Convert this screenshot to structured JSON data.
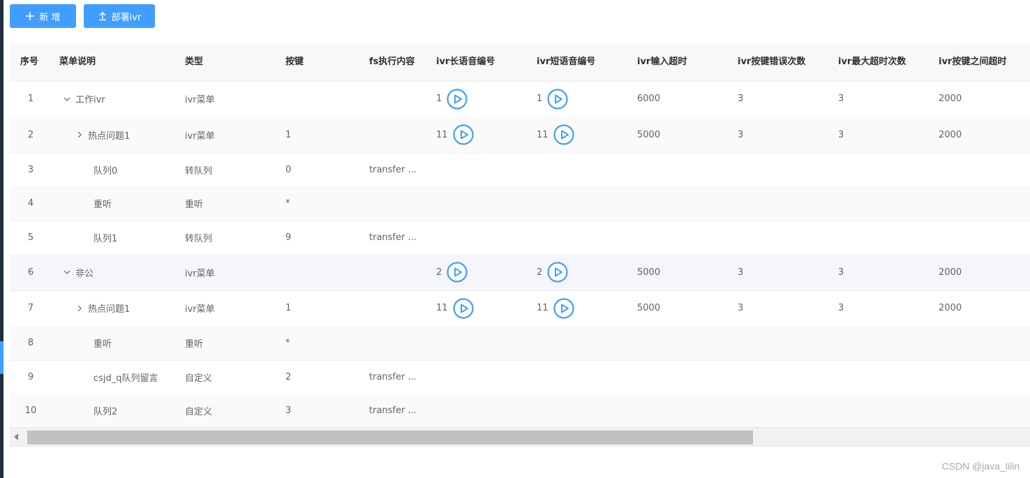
{
  "toolbar": {
    "add_label": "新 增",
    "deploy_label": "部署ivr"
  },
  "table": {
    "headers": {
      "index": "序号",
      "menu": "菜单说明",
      "type": "类型",
      "key": "按键",
      "fs": "fs执行内容",
      "long_voice": "ivr长语音编号",
      "short_voice": "ivr短语音编号",
      "input_timeout": "ivr输入超时",
      "key_errors": "ivr按键错误次数",
      "max_timeouts": "ivr最大超时次数",
      "inter_key_timeout": "ivr按键之间超时"
    },
    "rows": [
      {
        "index": "1",
        "menu": "工作ivr",
        "type": "ivr菜单",
        "key": "",
        "fs": "",
        "long_voice": "1",
        "short_voice": "1",
        "input_timeout": "6000",
        "key_errors": "3",
        "max_timeouts": "3",
        "inter_key_timeout": "2000"
      },
      {
        "index": "2",
        "menu": "热点问题1",
        "type": "ivr菜单",
        "key": "1",
        "fs": "",
        "long_voice": "11",
        "short_voice": "11",
        "input_timeout": "5000",
        "key_errors": "3",
        "max_timeouts": "3",
        "inter_key_timeout": "2000"
      },
      {
        "index": "3",
        "menu": "队列0",
        "type": "转队列",
        "key": "0",
        "fs": "transfer ...",
        "long_voice": "",
        "short_voice": "",
        "input_timeout": "",
        "key_errors": "",
        "max_timeouts": "",
        "inter_key_timeout": ""
      },
      {
        "index": "4",
        "menu": "重听",
        "type": "重听",
        "key": "*",
        "fs": "",
        "long_voice": "",
        "short_voice": "",
        "input_timeout": "",
        "key_errors": "",
        "max_timeouts": "",
        "inter_key_timeout": ""
      },
      {
        "index": "5",
        "menu": "队列1",
        "type": "转队列",
        "key": "9",
        "fs": "transfer ...",
        "long_voice": "",
        "short_voice": "",
        "input_timeout": "",
        "key_errors": "",
        "max_timeouts": "",
        "inter_key_timeout": ""
      },
      {
        "index": "6",
        "menu": "非公",
        "type": "ivr菜单",
        "key": "",
        "fs": "",
        "long_voice": "2",
        "short_voice": "2",
        "input_timeout": "5000",
        "key_errors": "3",
        "max_timeouts": "3",
        "inter_key_timeout": "2000"
      },
      {
        "index": "7",
        "menu": "热点问题1",
        "type": "ivr菜单",
        "key": "1",
        "fs": "",
        "long_voice": "11",
        "short_voice": "11",
        "input_timeout": "5000",
        "key_errors": "3",
        "max_timeouts": "3",
        "inter_key_timeout": "2000"
      },
      {
        "index": "8",
        "menu": "重听",
        "type": "重听",
        "key": "*",
        "fs": "",
        "long_voice": "",
        "short_voice": "",
        "input_timeout": "",
        "key_errors": "",
        "max_timeouts": "",
        "inter_key_timeout": ""
      },
      {
        "index": "9",
        "menu": "csjd_q队列留言",
        "type": "自定义",
        "key": "2",
        "fs": "transfer ...",
        "long_voice": "",
        "short_voice": "",
        "input_timeout": "",
        "key_errors": "",
        "max_timeouts": "",
        "inter_key_timeout": ""
      },
      {
        "index": "10",
        "menu": "队列2",
        "type": "自定义",
        "key": "3",
        "fs": "transfer ...",
        "long_voice": "",
        "short_voice": "",
        "input_timeout": "",
        "key_errors": "",
        "max_timeouts": "",
        "inter_key_timeout": ""
      }
    ]
  },
  "icons": {
    "add": "plus-icon",
    "deploy": "upload-icon",
    "play": "play-circle-icon",
    "expand_down": "chevron-down-icon",
    "expand_right": "chevron-right-icon"
  },
  "colors": {
    "primary": "#409eff",
    "header_bg": "#f7f8fa"
  },
  "watermark": "CSDN @java_lilin"
}
